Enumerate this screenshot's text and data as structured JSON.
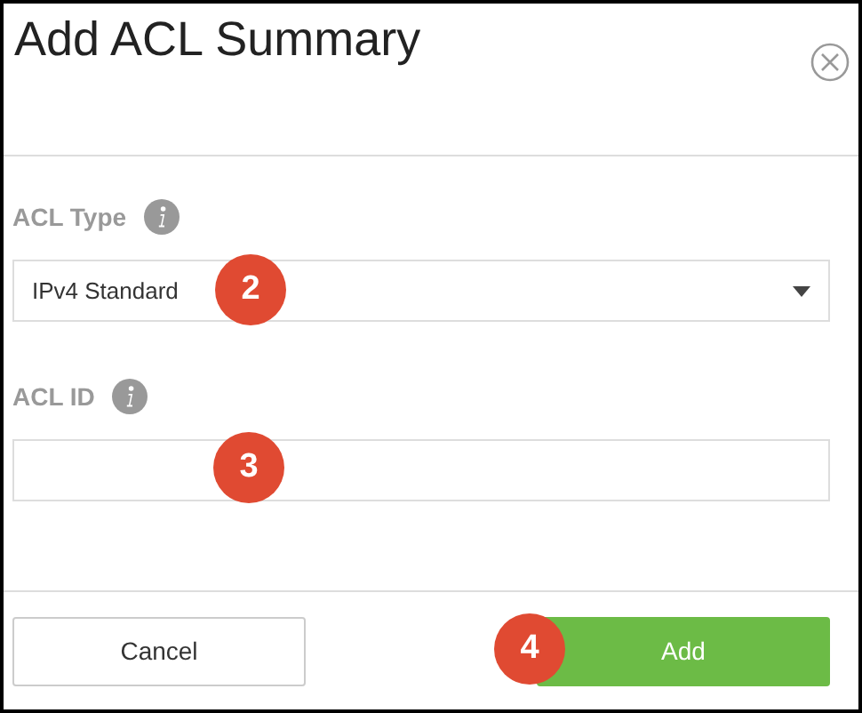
{
  "dialog": {
    "title": "Add ACL Summary"
  },
  "fields": [
    {
      "kind": "select",
      "label": "ACL Type",
      "value": "IPv4 Standard",
      "callout": "2"
    },
    {
      "kind": "text",
      "label": "ACL ID",
      "callout": "3"
    }
  ],
  "buttons": [
    {
      "label": "Cancel",
      "kind": "secondary"
    },
    {
      "label": "Add",
      "kind": "primary",
      "callout": "4"
    }
  ]
}
